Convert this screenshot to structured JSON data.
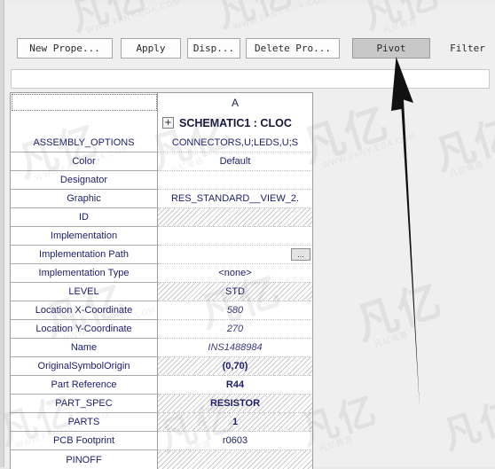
{
  "toolbar": {
    "buttons": [
      {
        "name": "new-property",
        "label": "New Prope...",
        "state": "normal"
      },
      {
        "name": "apply",
        "label": "Apply",
        "state": "normal"
      },
      {
        "name": "display",
        "label": "Disp...",
        "state": "normal"
      },
      {
        "name": "delete-property",
        "label": "Delete Pro...",
        "state": "normal"
      },
      {
        "name": "pivot",
        "label": "Pivot",
        "state": "pressed"
      },
      {
        "name": "filter",
        "label": "Filter",
        "state": "flat"
      }
    ]
  },
  "filter_bar": {
    "value": "",
    "placeholder": ""
  },
  "grid": {
    "column_header": "A",
    "row_header_corner": "",
    "object_title": "SCHEMATIC1 : CLOC",
    "expander_glyph": "+",
    "ellipsis_glyph": "...",
    "rows": [
      {
        "label": "ASSEMBLY_OPTIONS",
        "value": "CONNECTORS,U;LEDS,U;S",
        "style": "plain"
      },
      {
        "label": "Color",
        "value": "Default",
        "style": "plain"
      },
      {
        "label": "Designator",
        "value": "",
        "style": "plain"
      },
      {
        "label": "Graphic",
        "value": "RES_STANDARD__VIEW_2.",
        "style": "plain"
      },
      {
        "label": "ID",
        "value": "",
        "style": "hatched"
      },
      {
        "label": "Implementation",
        "value": "",
        "style": "plain"
      },
      {
        "label": "Implementation Path",
        "value": "",
        "style": "browse"
      },
      {
        "label": "Implementation Type",
        "value": "<none>",
        "style": "plain"
      },
      {
        "label": "LEVEL",
        "value": "STD",
        "style": "hatched"
      },
      {
        "label": "Location X-Coordinate",
        "value": "580",
        "style": "italic"
      },
      {
        "label": "Location Y-Coordinate",
        "value": "270",
        "style": "italic"
      },
      {
        "label": "Name",
        "value": "INS1488984",
        "style": "italic"
      },
      {
        "label": "OriginalSymbolOrigin",
        "value": "(0,70)",
        "style": "hatched-bold"
      },
      {
        "label": "Part Reference",
        "value": "R44",
        "style": "bold"
      },
      {
        "label": "PART_SPEC",
        "value": "RESISTOR",
        "style": "hatched-bold"
      },
      {
        "label": "PARTS",
        "value": "1",
        "style": "hatched-bold"
      },
      {
        "label": "PCB Footprint",
        "value": "r0603",
        "style": "plain"
      },
      {
        "label": "PINOFF",
        "value": "",
        "style": "hatched"
      }
    ]
  },
  "annotation": {
    "arrow_name": "callout-arrow-to-pivot",
    "arrow_color": "#111111",
    "points_to": "pivot"
  },
  "watermark": {
    "logo_text": "凡亿",
    "site_text_1": "WWW.FANY-EDA.COM",
    "site_text_2": "凡亿电路",
    "site_text_3": "凡亿教育",
    "color": "#7d7d7d"
  },
  "colors": {
    "window_bg": "#ececec",
    "toolbar_btn_bg": "#fdfdfd",
    "pressed_btn_bg": "#c8c8c8",
    "grid_text": "#1c1c6e",
    "grid_border": "#9c9c9c",
    "title_text": "#16163c"
  }
}
